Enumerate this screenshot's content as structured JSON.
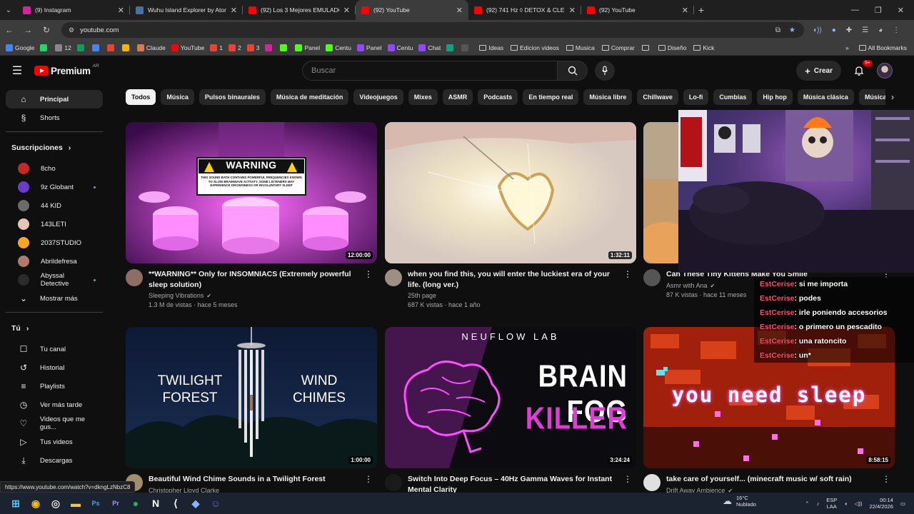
{
  "browser": {
    "tabs": [
      {
        "title": "(9) Instagram",
        "color": "#d6249f",
        "active": false
      },
      {
        "title": "Wuhu Island Explorer by Atom",
        "color": "#4a6fa5",
        "active": false
      },
      {
        "title": "(92) Los 3 Mejores EMULADOR",
        "color": "#ff0000",
        "active": false
      },
      {
        "title": "(92) YouTube",
        "color": "#ff0000",
        "active": true
      },
      {
        "title": "(92) 741 Hz ◊ DETOX & CLE",
        "color": "#ff0000",
        "active": false
      },
      {
        "title": "(92) YouTube",
        "color": "#ff0000",
        "active": false
      }
    ],
    "url": "youtube.com",
    "bookmarks": [
      {
        "label": "Google",
        "color": "#4285f4"
      },
      {
        "label": "",
        "color": "#25d366"
      },
      {
        "label": "12",
        "color": "#888888"
      },
      {
        "label": "",
        "color": "#0f9d58"
      },
      {
        "label": "",
        "color": "#4285f4"
      },
      {
        "label": "",
        "color": "#ea4335"
      },
      {
        "label": "",
        "color": "#f4b400"
      },
      {
        "label": "Claude",
        "color": "#d97757"
      },
      {
        "label": "YouTube",
        "color": "#ff0000"
      },
      {
        "label": "1",
        "color": "#ea4335"
      },
      {
        "label": "2",
        "color": "#ea4335"
      },
      {
        "label": "3",
        "color": "#ea4335"
      },
      {
        "label": "",
        "color": "#d6249f"
      },
      {
        "label": "",
        "color": "#53fc18"
      },
      {
        "label": "Panel",
        "color": "#53fc18"
      },
      {
        "label": "Centu",
        "color": "#53fc18"
      },
      {
        "label": "Panel",
        "color": "#9146ff"
      },
      {
        "label": "Centu",
        "color": "#9146ff"
      },
      {
        "label": "Chat",
        "color": "#9146ff"
      },
      {
        "label": "",
        "color": "#10a37f"
      },
      {
        "label": "",
        "color": "#555555"
      }
    ],
    "bookmark_folders": [
      "Ideas",
      "Edicion videos",
      "Musica",
      "Comprar",
      "",
      "Diseño",
      "Kick"
    ],
    "all_bookmarks": "All Bookmarks",
    "status_url": "https://www.youtube.com/watch?v=dkngLzNbzC8"
  },
  "header": {
    "logo_text": "Premium",
    "logo_country": "AR",
    "search_placeholder": "Buscar",
    "create_label": "Crear",
    "notif_badge": "9+"
  },
  "sidebar": {
    "main": [
      {
        "label": "Principal",
        "icon": "home-icon",
        "glyph": "⌂",
        "active": true
      },
      {
        "label": "Shorts",
        "icon": "shorts-icon",
        "glyph": "§",
        "active": false
      }
    ],
    "subs_title": "Suscripciones",
    "subs": [
      {
        "label": "8cho",
        "color": "#c62828",
        "live": false
      },
      {
        "label": "9z Globant",
        "color": "#6a3cc9",
        "live": true
      },
      {
        "label": "44 KID",
        "color": "#6b6b6b",
        "live": false
      },
      {
        "label": "143LETI",
        "color": "#e8c4b8",
        "live": false
      },
      {
        "label": "2037STUDIO",
        "color": "#f5a623",
        "live": false
      },
      {
        "label": "Abrildefresa",
        "color": "#b07a6a",
        "live": false
      },
      {
        "label": "Abyssal Detective",
        "color": "#2b2b2b",
        "live": true
      }
    ],
    "show_more": "Mostrar más",
    "you_title": "Tú",
    "you_items": [
      {
        "label": "Tu canal",
        "icon": "channel-icon",
        "glyph": "☐"
      },
      {
        "label": "Historial",
        "icon": "history-icon",
        "glyph": "↺"
      },
      {
        "label": "Playlists",
        "icon": "playlists-icon",
        "glyph": "≡"
      },
      {
        "label": "Ver más tarde",
        "icon": "watch-later-icon",
        "glyph": "◷"
      },
      {
        "label": "Videos que me gus...",
        "icon": "like-icon",
        "glyph": "♡"
      },
      {
        "label": "Tus videos",
        "icon": "your-videos-icon",
        "glyph": "▷"
      },
      {
        "label": "Descargas",
        "icon": "download-icon",
        "glyph": "⤓"
      }
    ]
  },
  "chips": [
    "Todos",
    "Música",
    "Pulsos binaurales",
    "Música de meditación",
    "Videojuegos",
    "Mixes",
    "ASMR",
    "Podcasts",
    "En tiempo real",
    "Música libre",
    "Chillwave",
    "Lo-fi",
    "Cumbias",
    "Hip hop",
    "Música clásica",
    "Música"
  ],
  "videos": [
    {
      "title": "**WARNING** Only for INSOMNIACS (Extremely powerful sleep solution)",
      "channel": "Sleeping Vibrations",
      "verified": true,
      "stats": "1.3 M de vistas · hace 5 meses",
      "duration": "12:00:00",
      "thumb_text": "WARNING",
      "thumb_sub": "THIS SOUND BATH CONTAINS POWERFUL FREQUENCIES KNOWN TO SLOW BRAINWAVE ACTIVITY. SOME LISTENERS MAY EXPERIENCE DROWSINESS OR INVOLUNTARY SLEEP",
      "av_color": "#8d6e63"
    },
    {
      "title": "when you find this, you will enter the luckiest era of your life. (long ver.)",
      "channel": "25th page",
      "verified": false,
      "stats": "687 K vistas · hace 1 año",
      "duration": "1:32:11",
      "av_color": "#9e8f84"
    },
    {
      "title": "Can These Tiny Kittens Make You Smile",
      "channel": "Asmr with Ana",
      "verified": true,
      "stats": "87 K vistas · hace 11 meses",
      "av_color": "#555555"
    },
    {
      "title": "Beautiful Wind Chime Sounds in a Twilight Forest",
      "channel": "Christopher Lloyd Clarke",
      "verified": false,
      "stats": "",
      "duration": "1:00:00",
      "thumb_left": "TWILIGHT FOREST",
      "thumb_right": "WIND CHIMES",
      "av_color": "#a08f6a"
    },
    {
      "title": "Switch Into Deep Focus – 40Hz Gamma Waves for Instant Mental Clarity",
      "channel": "",
      "verified": false,
      "stats": "",
      "duration": "3:24:24",
      "thumb_brand": "NEUFLOW LAB",
      "thumb_l1": "BRAIN FOG",
      "thumb_l2": "KILLER",
      "av_color": "#1a1a1a"
    },
    {
      "title": "take care of yourself... (minecraft music w/ soft rain)",
      "channel": "Drift Away Ambience",
      "verified": true,
      "stats": "",
      "duration": "8:58:15",
      "thumb_text": "you need sleep",
      "av_color": "#e0e0e0"
    }
  ],
  "chat": [
    {
      "user": "EstCerise",
      "msg": ": si me importa"
    },
    {
      "user": "EstCerise",
      "msg": ": podes"
    },
    {
      "user": "EstCerise",
      "msg": ": irle poniendo accesorios"
    },
    {
      "user": "EstCerise",
      "msg": ": o primero un pescadito"
    },
    {
      "user": "EstCerise",
      "msg": ": una ratoncito"
    },
    {
      "user": "EstCerise",
      "msg": ": un*"
    }
  ],
  "taskbar": {
    "apps": [
      {
        "name": "windows-start-icon",
        "color": "#4cc2ff",
        "glyph": "⊞"
      },
      {
        "name": "chrome-icon",
        "color": "#fbbc05",
        "glyph": "◉"
      },
      {
        "name": "obs-icon",
        "color": "#dddddd",
        "glyph": "◎"
      },
      {
        "name": "file-explorer-icon",
        "color": "#f4c542",
        "glyph": "▬"
      },
      {
        "name": "photoshop-icon",
        "color": "#31a8ff",
        "glyph": "Ps"
      },
      {
        "name": "premiere-icon",
        "color": "#9999ff",
        "glyph": "Pr"
      },
      {
        "name": "spotify-icon",
        "color": "#1db954",
        "glyph": "●"
      },
      {
        "name": "notion-icon",
        "color": "#ffffff",
        "glyph": "N"
      },
      {
        "name": "capcut-icon",
        "color": "#ffffff",
        "glyph": "⟨"
      },
      {
        "name": "app-icon",
        "color": "#8ab4f8",
        "glyph": "◆"
      },
      {
        "name": "discord-icon",
        "color": "#5865f2",
        "glyph": "☺"
      }
    ],
    "weather_temp": "16°C",
    "weather_desc": "Nublado",
    "lang_1": "ESP",
    "lang_2": "LAA",
    "time": "00:14",
    "date": "22/4/2026"
  }
}
